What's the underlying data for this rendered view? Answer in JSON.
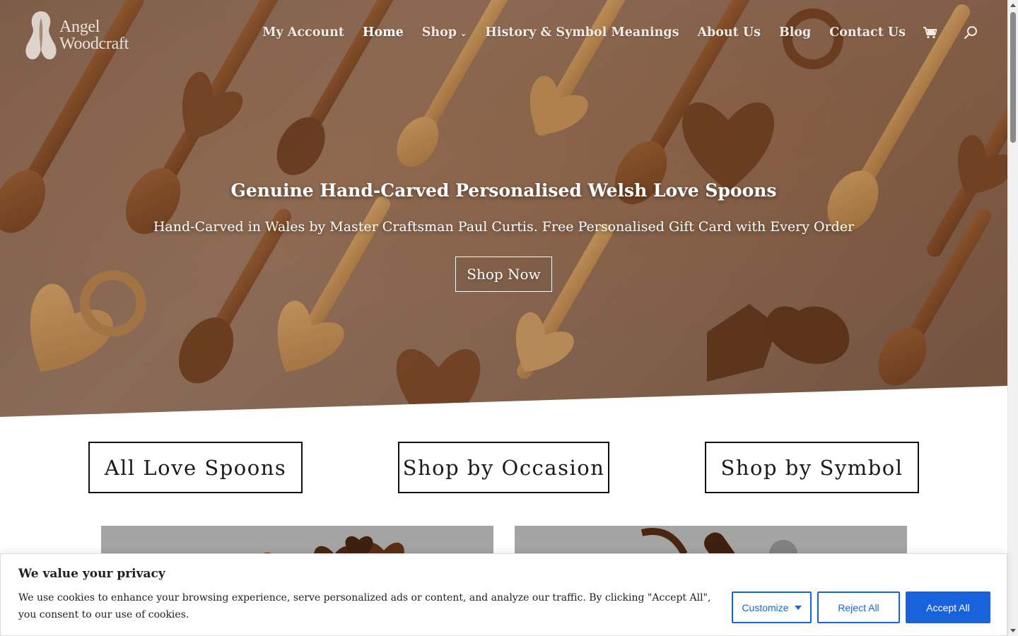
{
  "header": {
    "logo_text_line1": "Angel",
    "logo_text_line2": "Woodcraft",
    "nav": [
      {
        "label": "My Account"
      },
      {
        "label": "Home"
      },
      {
        "label": "Shop"
      },
      {
        "label": "History & Symbol Meanings"
      },
      {
        "label": "About Us"
      },
      {
        "label": "Blog"
      },
      {
        "label": "Contact Us"
      }
    ],
    "icons": {
      "cart": "cart-icon",
      "search": "search-icon",
      "dropdown": "chevron-down-icon"
    }
  },
  "hero": {
    "title": "Genuine Hand-Carved Personalised Welsh Love Spoons",
    "subtitle": "Hand-Carved in Wales by Master Craftsman Paul Curtis. Free Personalised Gift Card with Every Order",
    "button": "Shop Now"
  },
  "categories": [
    {
      "label": "All Love Spoons"
    },
    {
      "label": "Shop by Occasion"
    },
    {
      "label": "Shop by Symbol"
    }
  ],
  "cookie_banner": {
    "title": "We value your privacy",
    "text": "We use cookies to enhance your browsing experience, serve personalized ads or content, and analyze our traffic. By clicking \"Accept All\", you consent to our use of cookies.",
    "customize": "Customize",
    "reject": "Reject All",
    "accept": "Accept All"
  },
  "colors": {
    "accent": "#1863dc",
    "hero_tone": "#8b6a55",
    "text": "#212121"
  }
}
